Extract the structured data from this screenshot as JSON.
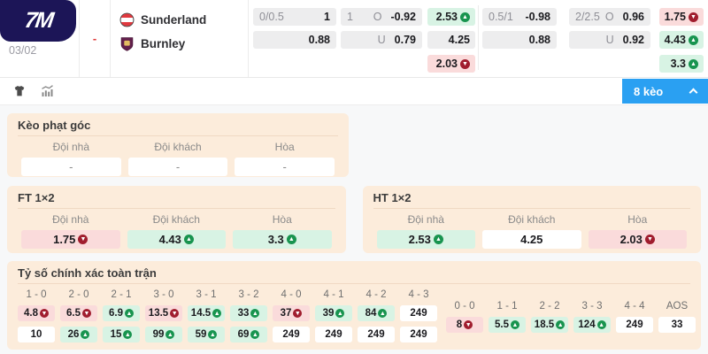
{
  "brand": {
    "logo_text": "7M"
  },
  "match": {
    "date": "03/02",
    "status": "-",
    "home": "Sunderland",
    "away": "Burnley",
    "home_crest": "sunderland-crest",
    "away_crest": "burnley-crest"
  },
  "odds": {
    "ht": {
      "hcap_line": "0/0.5",
      "hcap_r1": "1",
      "hcap_r2": "0.88",
      "total_line": "1",
      "over_label": "O",
      "under_label": "U",
      "total_r1": "-0.92",
      "total_r2": "0.79",
      "x12_r1": {
        "v": "2.53",
        "t": "up"
      },
      "x12_r2": {
        "v": "4.25",
        "t": "flat"
      },
      "x12_r3": {
        "v": "2.03",
        "t": "down"
      }
    },
    "ft": {
      "hcap_line": "0.5/1",
      "hcap_r1": "-0.98",
      "hcap_r2": "0.88",
      "total_line": "2/2.5",
      "over_label": "O",
      "under_label": "U",
      "total_r1": "0.96",
      "total_r2": "0.92",
      "x12_r1": {
        "v": "1.75",
        "t": "down"
      },
      "x12_r2": {
        "v": "4.43",
        "t": "up"
      },
      "x12_r3": {
        "v": "3.3",
        "t": "up"
      }
    }
  },
  "toolbar": {
    "bets_button": "8 kèo",
    "icons": [
      "jersey-icon",
      "stats-chart-icon",
      "chevron-up-icon"
    ]
  },
  "corner_panel": {
    "title": "Kèo phạt góc",
    "cols": [
      {
        "h": "Đội nhà",
        "v": "-",
        "t": "flat"
      },
      {
        "h": "Đội khách",
        "v": "-",
        "t": "flat"
      },
      {
        "h": "Hòa",
        "v": "-",
        "t": "flat"
      }
    ]
  },
  "ft_panel": {
    "title": "FT 1×2",
    "cols": [
      {
        "h": "Đội nhà",
        "v": "1.75",
        "t": "down"
      },
      {
        "h": "Đội khách",
        "v": "4.43",
        "t": "up"
      },
      {
        "h": "Hòa",
        "v": "3.3",
        "t": "up"
      }
    ]
  },
  "ht_panel": {
    "title": "HT 1×2",
    "cols": [
      {
        "h": "Đội nhà",
        "v": "2.53",
        "t": "up"
      },
      {
        "h": "Đội khách",
        "v": "4.25",
        "t": "flat"
      },
      {
        "h": "Hòa",
        "v": "2.03",
        "t": "down"
      }
    ]
  },
  "score_panel": {
    "title": "Tỷ số chính xác toàn trận",
    "main": [
      {
        "label": "1 - 0",
        "r1v": "4.8",
        "r1t": "down",
        "r2v": "10",
        "r2t": "flat"
      },
      {
        "label": "2 - 0",
        "r1v": "6.5",
        "r1t": "down",
        "r2v": "26",
        "r2t": "up"
      },
      {
        "label": "2 - 1",
        "r1v": "6.9",
        "r1t": "up",
        "r2v": "15",
        "r2t": "up"
      },
      {
        "label": "3 - 0",
        "r1v": "13.5",
        "r1t": "down",
        "r2v": "99",
        "r2t": "up"
      },
      {
        "label": "3 - 1",
        "r1v": "14.5",
        "r1t": "up",
        "r2v": "59",
        "r2t": "up"
      },
      {
        "label": "3 - 2",
        "r1v": "33",
        "r1t": "up",
        "r2v": "69",
        "r2t": "up"
      },
      {
        "label": "4 - 0",
        "r1v": "37",
        "r1t": "down",
        "r2v": "249",
        "r2t": "flat"
      },
      {
        "label": "4 - 1",
        "r1v": "39",
        "r1t": "up",
        "r2v": "249",
        "r2t": "flat"
      },
      {
        "label": "4 - 2",
        "r1v": "84",
        "r1t": "up",
        "r2v": "249",
        "r2t": "flat"
      },
      {
        "label": "4 - 3",
        "r1v": "249",
        "r1t": "flat",
        "r2v": "249",
        "r2t": "flat"
      }
    ],
    "draw": [
      {
        "label": "0 - 0",
        "v": "8",
        "t": "down"
      },
      {
        "label": "1 - 1",
        "v": "5.5",
        "t": "up"
      },
      {
        "label": "2 - 2",
        "v": "18.5",
        "t": "up"
      },
      {
        "label": "3 - 3",
        "v": "124",
        "t": "up"
      },
      {
        "label": "4 - 4",
        "v": "249",
        "t": "flat"
      },
      {
        "label": "AOS",
        "v": "33",
        "t": "flat"
      }
    ]
  },
  "colors": {
    "accent_blue": "#2aa0f2",
    "trend_up_green": "#18944f",
    "trend_down_red": "#a01d2e",
    "panel_peach": "#fcecdb",
    "logo_navy": "#1c1557"
  }
}
